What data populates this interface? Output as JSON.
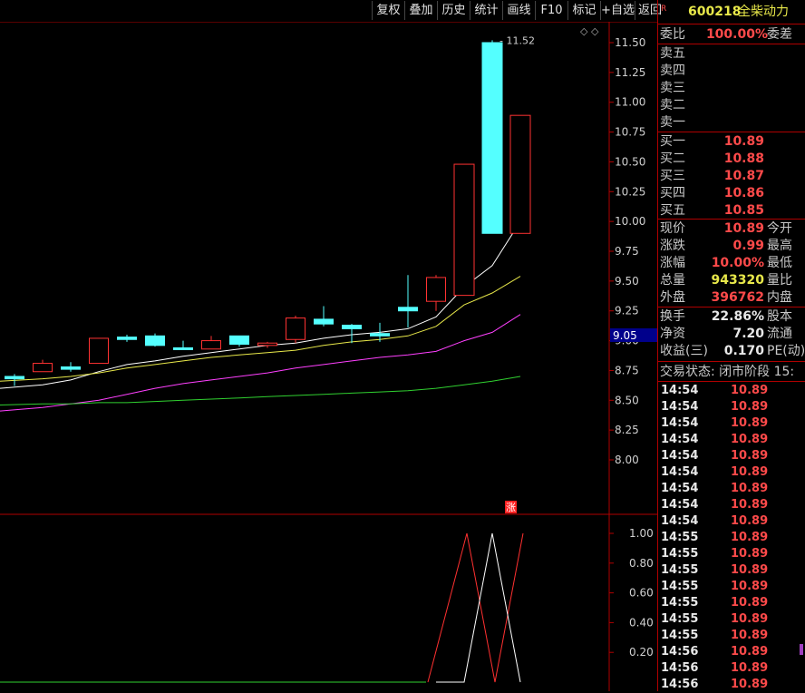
{
  "toolbar": {
    "buttons": [
      "复权",
      "叠加",
      "历史",
      "统计",
      "画线",
      "F10",
      "标记",
      "+自选",
      "返回"
    ]
  },
  "main_chart": {
    "y_ticks": [
      "11.50",
      "11.25",
      "11.00",
      "10.75",
      "10.50",
      "10.25",
      "10.00",
      "9.75",
      "9.50",
      "9.25",
      "9.00",
      "8.75",
      "8.50",
      "8.25",
      "8.00"
    ],
    "y_tick_values": [
      11.5,
      11.25,
      11.0,
      10.75,
      10.5,
      10.25,
      10.0,
      9.75,
      9.5,
      9.25,
      9.0,
      8.75,
      8.5,
      8.25,
      8.0
    ],
    "high_label": "11.52",
    "current_price_tag": "9.05",
    "zhang_badge": "涨",
    "nav_arrows": "◇ ◇"
  },
  "sub_chart": {
    "y_ticks": [
      "1.00",
      "0.80",
      "0.60",
      "0.40",
      "0.20"
    ],
    "y_tick_values": [
      1.0,
      0.8,
      0.6,
      0.4,
      0.2
    ]
  },
  "quote": {
    "code": "600218",
    "name": "全柴动力",
    "r_mark": "R",
    "weibi_label": "委比",
    "weibi_value": "100.00%",
    "weicha_label": "委差",
    "sell": [
      {
        "label": "卖五",
        "price": ""
      },
      {
        "label": "卖四",
        "price": ""
      },
      {
        "label": "卖三",
        "price": ""
      },
      {
        "label": "卖二",
        "price": ""
      },
      {
        "label": "卖一",
        "price": ""
      }
    ],
    "buy": [
      {
        "label": "买一",
        "price": "10.89"
      },
      {
        "label": "买二",
        "price": "10.88"
      },
      {
        "label": "买三",
        "price": "10.87"
      },
      {
        "label": "买四",
        "price": "10.86"
      },
      {
        "label": "买五",
        "price": "10.85"
      }
    ],
    "stats1": [
      {
        "label": "现价",
        "value": "10.89",
        "label2": "今开",
        "color": "#ff4a4a"
      },
      {
        "label": "涨跌",
        "value": "0.99",
        "label2": "最高",
        "color": "#ff4a4a"
      },
      {
        "label": "涨幅",
        "value": "10.00%",
        "label2": "最低",
        "color": "#ff4a4a"
      },
      {
        "label": "总量",
        "value": "943320",
        "label2": "量比",
        "color": "#e8e84a"
      },
      {
        "label": "外盘",
        "value": "396762",
        "label2": "内盘",
        "color": "#ff4a4a"
      }
    ],
    "stats2": [
      {
        "label": "换手",
        "value": "22.86%",
        "label2": "股本",
        "color": "#e8e8e8"
      },
      {
        "label": "净资",
        "value": "7.20",
        "label2": "流通",
        "color": "#e8e8e8"
      },
      {
        "label": "收益(三)",
        "value": "0.170",
        "label2": "PE(动)",
        "color": "#e8e8e8"
      }
    ],
    "trade_status": "交易状态: 闭市阶段 15:"
  },
  "ticks": [
    {
      "time": "14:54",
      "price": "10.89"
    },
    {
      "time": "14:54",
      "price": "10.89"
    },
    {
      "time": "14:54",
      "price": "10.89"
    },
    {
      "time": "14:54",
      "price": "10.89"
    },
    {
      "time": "14:54",
      "price": "10.89"
    },
    {
      "time": "14:54",
      "price": "10.89"
    },
    {
      "time": "14:54",
      "price": "10.89"
    },
    {
      "time": "14:54",
      "price": "10.89"
    },
    {
      "time": "14:54",
      "price": "10.89"
    },
    {
      "time": "14:55",
      "price": "10.89"
    },
    {
      "time": "14:55",
      "price": "10.89"
    },
    {
      "time": "14:55",
      "price": "10.89"
    },
    {
      "time": "14:55",
      "price": "10.89"
    },
    {
      "time": "14:55",
      "price": "10.89"
    },
    {
      "time": "14:55",
      "price": "10.89"
    },
    {
      "time": "14:55",
      "price": "10.89"
    },
    {
      "time": "14:56",
      "price": "10.89"
    },
    {
      "time": "14:56",
      "price": "10.89"
    },
    {
      "time": "14:56",
      "price": "10.89"
    }
  ],
  "chart_data": {
    "type": "candlestick",
    "candles": [
      {
        "o": 8.7,
        "c": 8.68,
        "h": 8.72,
        "l": 8.62
      },
      {
        "o": 8.74,
        "c": 8.81,
        "h": 8.84,
        "l": 8.74
      },
      {
        "o": 8.78,
        "c": 8.76,
        "h": 8.82,
        "l": 8.74
      },
      {
        "o": 8.81,
        "c": 9.02,
        "h": 9.02,
        "l": 8.81
      },
      {
        "o": 9.03,
        "c": 9.01,
        "h": 9.05,
        "l": 8.99
      },
      {
        "o": 9.04,
        "c": 8.96,
        "h": 9.06,
        "l": 8.95
      },
      {
        "o": 8.94,
        "c": 8.93,
        "h": 9.0,
        "l": 8.93
      },
      {
        "o": 8.93,
        "c": 9.0,
        "h": 9.04,
        "l": 8.93
      },
      {
        "o": 9.04,
        "c": 8.97,
        "h": 9.04,
        "l": 8.95
      },
      {
        "o": 8.96,
        "c": 8.98,
        "h": 8.99,
        "l": 8.94
      },
      {
        "o": 9.01,
        "c": 9.19,
        "h": 9.21,
        "l": 8.98
      },
      {
        "o": 9.18,
        "c": 9.14,
        "h": 9.29,
        "l": 9.12
      },
      {
        "o": 9.13,
        "c": 9.1,
        "h": 9.14,
        "l": 8.98
      },
      {
        "o": 9.06,
        "c": 9.04,
        "h": 9.15,
        "l": 8.99
      },
      {
        "o": 9.28,
        "c": 9.25,
        "h": 9.55,
        "l": 9.11
      },
      {
        "o": 9.33,
        "c": 9.53,
        "h": 9.55,
        "l": 9.25
      },
      {
        "o": 9.38,
        "c": 10.48,
        "h": 10.48,
        "l": 9.38
      },
      {
        "o": 11.5,
        "c": 9.9,
        "h": 11.52,
        "l": 9.9
      },
      {
        "o": 9.9,
        "c": 10.89,
        "h": 10.89,
        "l": 9.9
      }
    ],
    "ma_lines": [
      {
        "color": "#ffffff",
        "values": [
          8.6,
          8.63,
          8.67,
          8.74,
          8.8,
          8.83,
          8.87,
          8.9,
          8.93,
          8.96,
          8.98,
          9.02,
          9.05,
          9.07,
          9.1,
          9.2,
          9.45,
          9.63,
          10.0
        ]
      },
      {
        "color": "#e8e84a",
        "values": [
          8.66,
          8.68,
          8.7,
          8.73,
          8.77,
          8.8,
          8.83,
          8.86,
          8.88,
          8.9,
          8.92,
          8.96,
          8.99,
          9.01,
          9.04,
          9.12,
          9.3,
          9.4,
          9.54
        ]
      },
      {
        "color": "#ff40ff",
        "values": [
          8.41,
          8.44,
          8.47,
          8.5,
          8.55,
          8.6,
          8.64,
          8.67,
          8.7,
          8.73,
          8.77,
          8.8,
          8.83,
          8.86,
          8.88,
          8.91,
          9.0,
          9.07,
          9.22
        ]
      },
      {
        "color": "#30d030",
        "values": [
          8.46,
          8.47,
          8.47,
          8.48,
          8.48,
          8.49,
          8.5,
          8.51,
          8.52,
          8.53,
          8.54,
          8.55,
          8.56,
          8.57,
          8.58,
          8.6,
          8.63,
          8.66,
          8.7
        ]
      }
    ],
    "ylim": [
      7.7,
      11.65
    ],
    "sub_ylim": [
      0,
      1.05
    ],
    "sub_lines": [
      {
        "color": "#ff3030",
        "values": [
          0,
          0,
          0,
          0,
          0,
          0,
          0,
          0,
          0,
          0,
          0,
          0,
          0,
          0,
          0,
          0,
          1,
          0,
          1
        ]
      },
      {
        "color": "#ffffff",
        "values": [
          0,
          0,
          0,
          0,
          0,
          0,
          0,
          0,
          0,
          0,
          0,
          0,
          0,
          0,
          0,
          0,
          0,
          1,
          0
        ]
      }
    ],
    "sub_line_start_index": 15,
    "sub_baseline_color": "#30d030"
  }
}
